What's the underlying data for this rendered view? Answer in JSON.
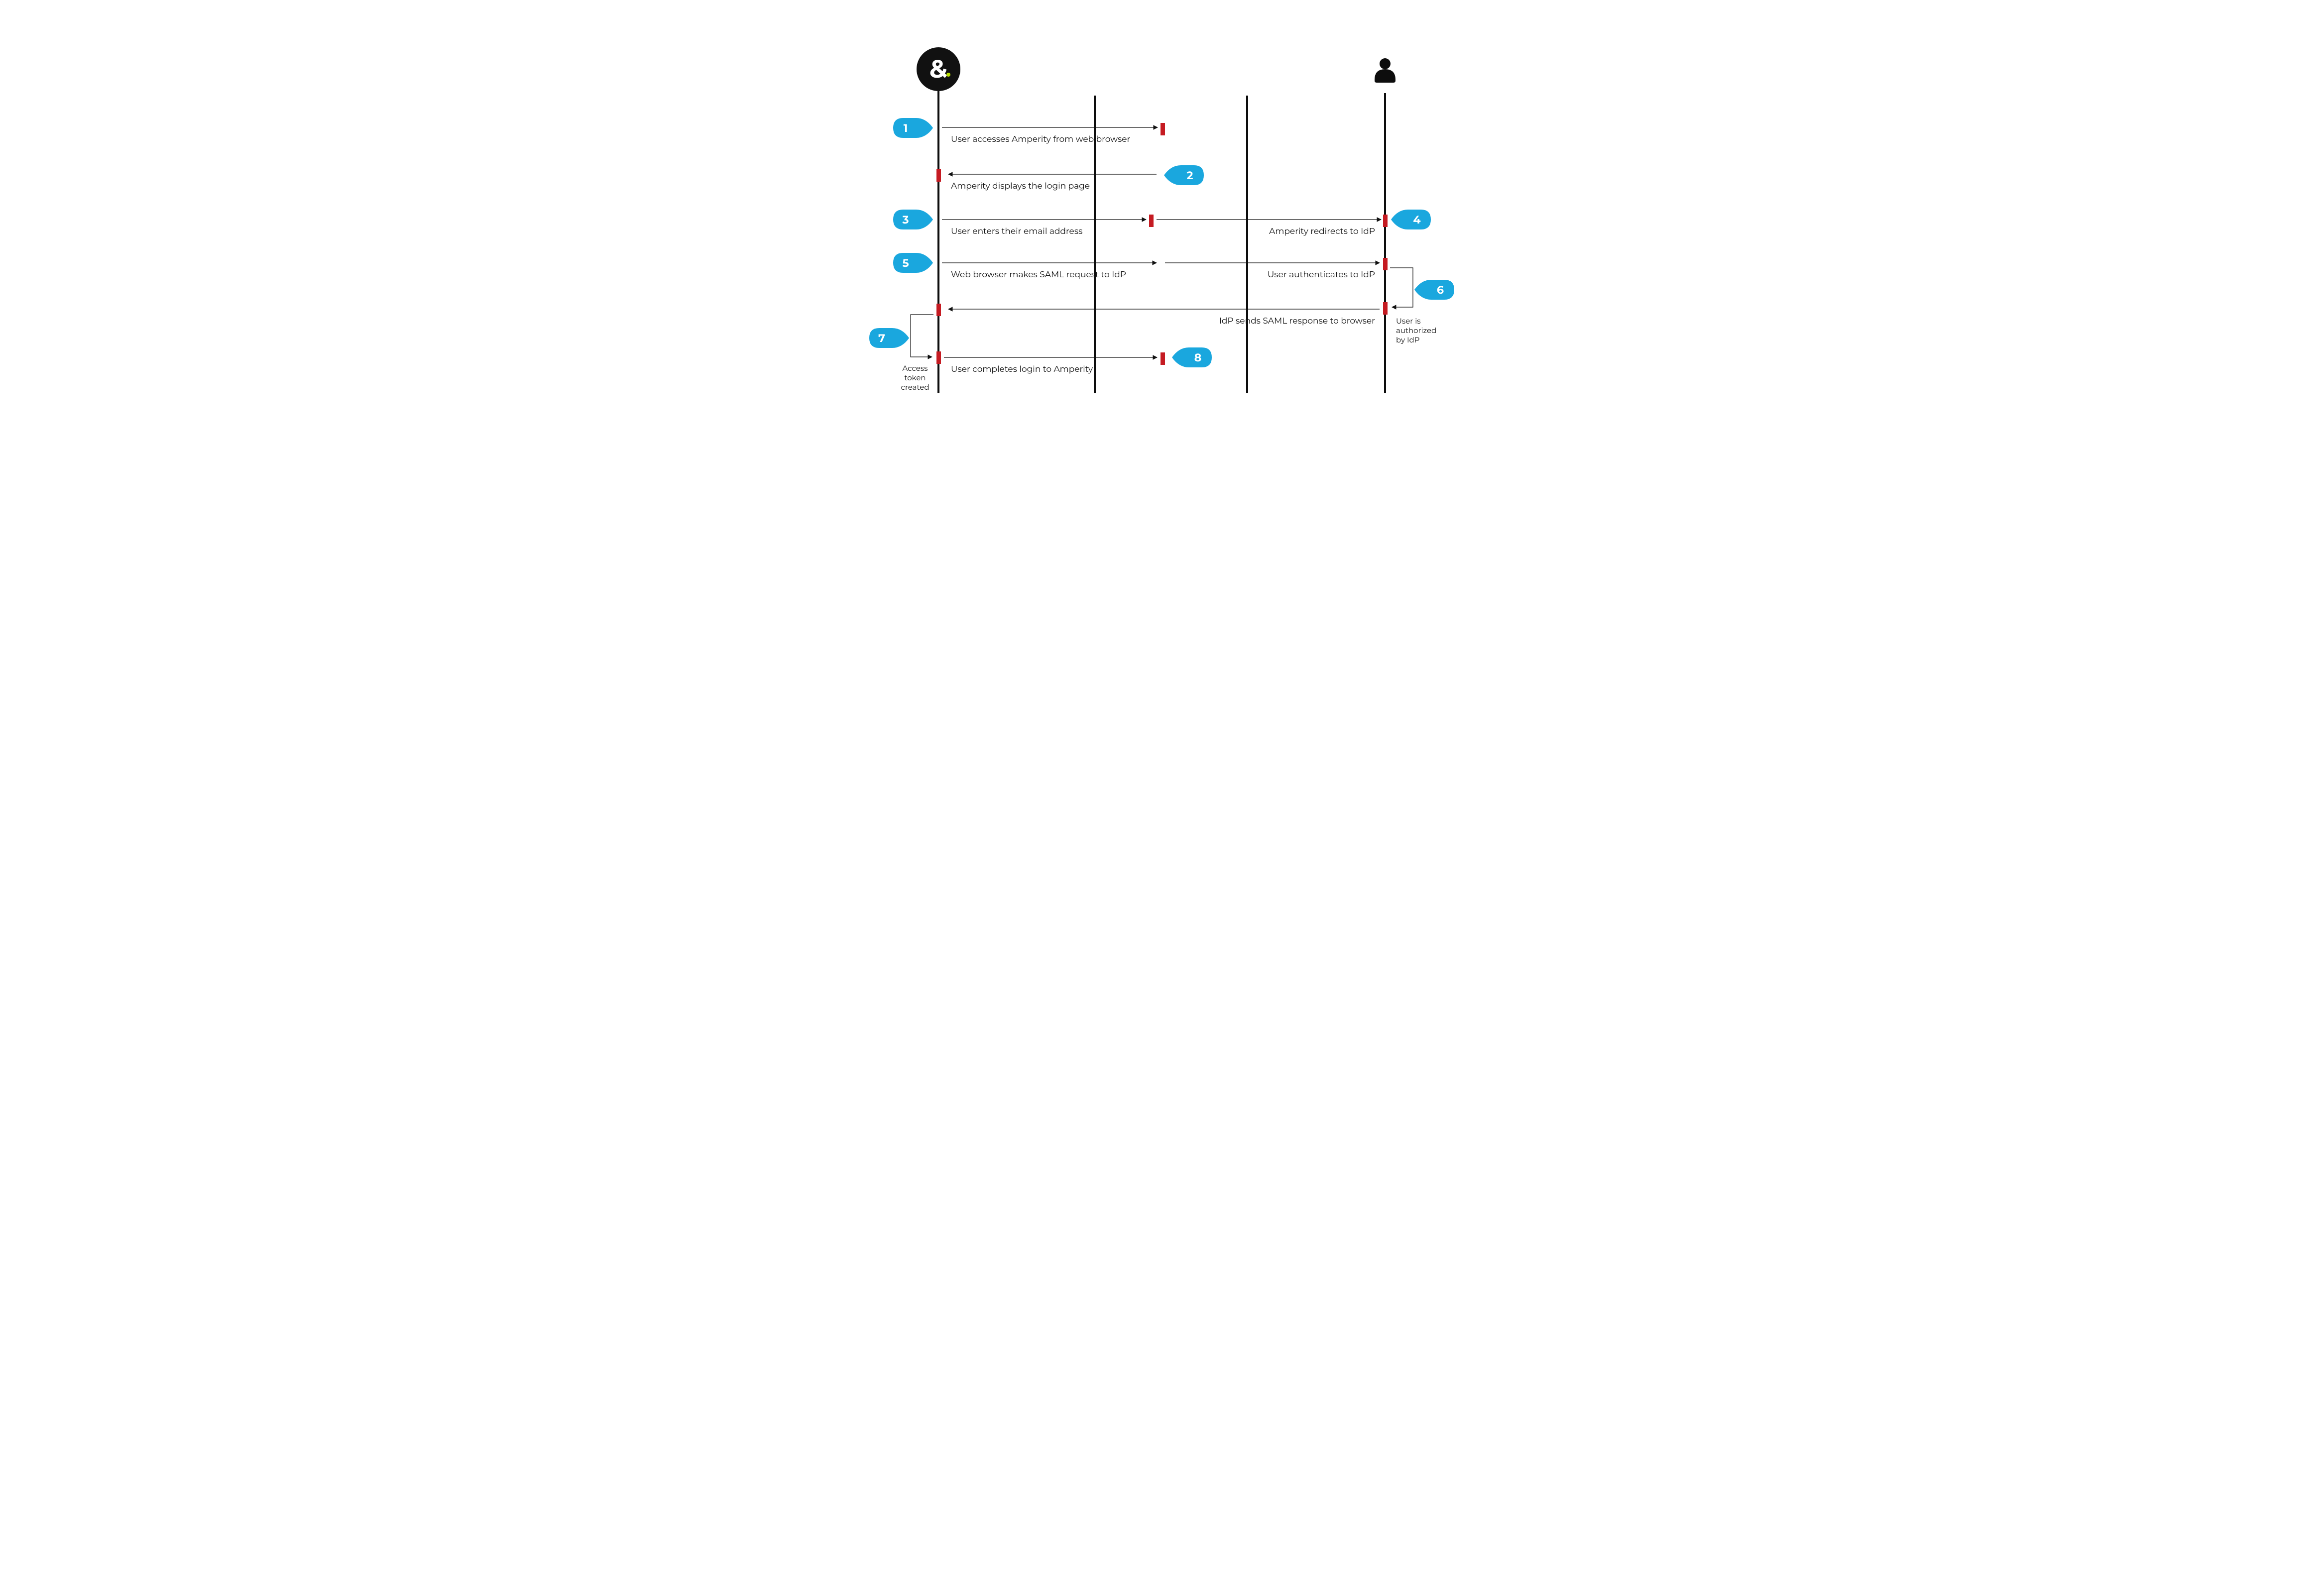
{
  "actors": {
    "app_icon_label": "&",
    "user_icon_label": "user"
  },
  "steps": {
    "s1": {
      "num": "1",
      "text": "User accesses Amperity from web browser"
    },
    "s2": {
      "num": "2",
      "text": "Amperity displays the login page"
    },
    "s3": {
      "num": "3",
      "text": "User enters their email address"
    },
    "s4": {
      "num": "4",
      "text": "Amperity redirects to IdP"
    },
    "s5": {
      "num": "5",
      "text": "Web browser makes SAML request to IdP"
    },
    "s5b": {
      "text": "User authenticates to IdP"
    },
    "s6": {
      "num": "6",
      "text_l1": "User is",
      "text_l2": "authorized",
      "text_l3": "by IdP"
    },
    "s6b": {
      "text": "IdP sends SAML response to browser"
    },
    "s7": {
      "num": "7",
      "text_l1": "Access",
      "text_l2": "token",
      "text_l3": "created"
    },
    "s8": {
      "num": "8",
      "text": "User completes login to Amperity"
    }
  },
  "colors": {
    "accent": "#1aa7de",
    "ink": "#111",
    "activation": "#c51b22"
  }
}
